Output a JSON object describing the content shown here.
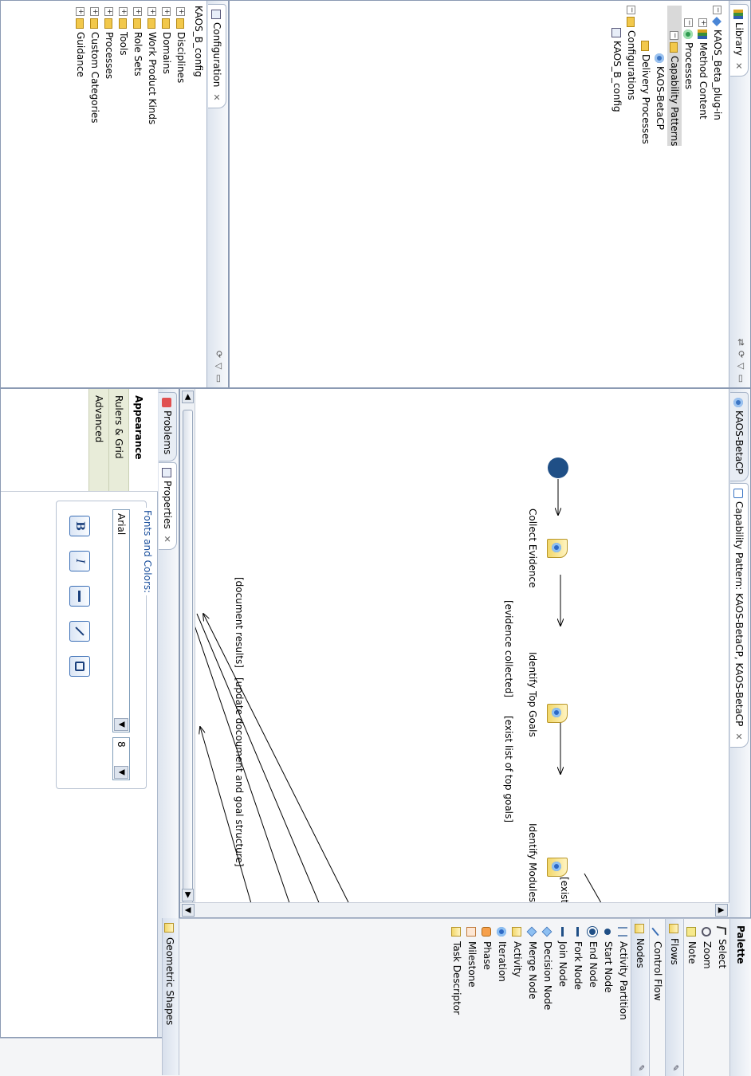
{
  "library": {
    "tab_label": "Library",
    "tree": [
      {
        "label": "KAOS_Beta_plug-in",
        "indent": 0,
        "expander": "⊟"
      },
      {
        "label": "Method Content",
        "indent": 1,
        "expander": "⊞"
      },
      {
        "label": "Processes",
        "indent": 1,
        "expander": "⊟"
      },
      {
        "label": "Capability Patterns",
        "indent": 2,
        "expander": "⊟"
      },
      {
        "label": "KAOS-BetaCP",
        "indent": 3,
        "expander": ""
      },
      {
        "label": "Delivery Processes",
        "indent": 2,
        "expander": ""
      },
      {
        "label": "Configurations",
        "indent": 0,
        "expander": "⊟"
      },
      {
        "label": "KAOS_B_config",
        "indent": 1,
        "expander": ""
      }
    ]
  },
  "configuration": {
    "tab_label": "Configuration",
    "config_name": "KAOS_B_config",
    "items": [
      "Disciplines",
      "Domains",
      "Work Product Kinds",
      "Role Sets",
      "Tools",
      "Processes",
      "Custom Categories",
      "Guidance"
    ]
  },
  "editor": {
    "tab1_label": "KAOS-BetaCP",
    "tab2_label": "Capability Pattern: KAOS-BetaCP, KAOS-BetaCP",
    "nodes": {
      "collect_evidence": "Collect Evidence",
      "identify_top_goals": "Identify Top Goals",
      "identify_modules": "Identify Modules"
    },
    "guards": {
      "evidence_collected": "[evidence collected]",
      "exist_list_top_goals": "[exist list of top goals]",
      "exist_partial": "[exist l",
      "document_results": "[document results]",
      "update_document": "[update docoument and goal structure]"
    }
  },
  "palette": {
    "title": "Palette",
    "tools": [
      "Select",
      "Zoom",
      "Note"
    ],
    "flows_drawer": "Flows",
    "flows": [
      "Control Flow"
    ],
    "nodes_drawer": "Nodes",
    "nodes": [
      "Activity Partition",
      "Start Node",
      "End Node",
      "Fork Node",
      "Join Node",
      "Decision Node",
      "Merge Node",
      "Activity",
      "Iteration",
      "Phase",
      "Milestone",
      "Task Descriptor"
    ],
    "geometric_drawer": "Geometric Shapes"
  },
  "properties": {
    "problems_tab": "Problems",
    "properties_tab": "Properties",
    "sections": [
      "Appearance",
      "Rulers & Grid",
      "Advanced"
    ],
    "group_title": "Fonts and Colors:",
    "font_name": "Arial",
    "font_size": "8",
    "buttons": {
      "bold": "B",
      "italic": "I"
    }
  },
  "colors": {
    "accent": "#1f4f86",
    "task_fill": "#f2d76a",
    "panel_border": "#8b9ab3"
  }
}
